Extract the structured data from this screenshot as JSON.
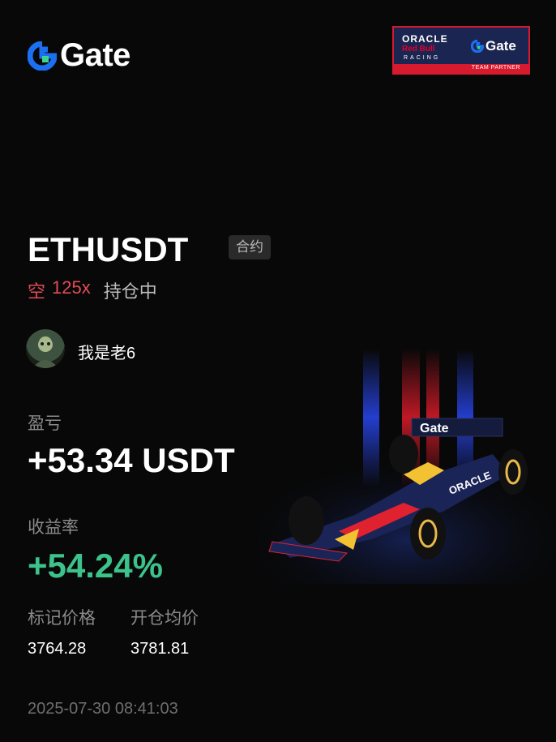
{
  "brand": {
    "name": "Gate",
    "logo_color": "#1c6ff0"
  },
  "partner": {
    "oracle": "ORACLE",
    "redbull": "Red Bull",
    "racing": "RACING",
    "gate": "Gate",
    "footer": "TEAM PARTNER"
  },
  "position": {
    "symbol": "ETHUSDT",
    "type": "合约",
    "side": "空",
    "leverage": "125x",
    "status": "持仓中"
  },
  "user": {
    "name": "我是老6"
  },
  "pnl": {
    "label": "盈亏",
    "value": "+53.34 USDT"
  },
  "roi": {
    "label": "收益率",
    "value": "+54.24%",
    "color": "#3cc28a"
  },
  "mark_price": {
    "label": "标记价格",
    "value": "3764.28"
  },
  "entry_price": {
    "label": "开仓均价",
    "value": "3781.81"
  },
  "timestamp": "2025-07-30 08:41:03",
  "colors": {
    "short": "#e14b57",
    "background": "#080808"
  }
}
